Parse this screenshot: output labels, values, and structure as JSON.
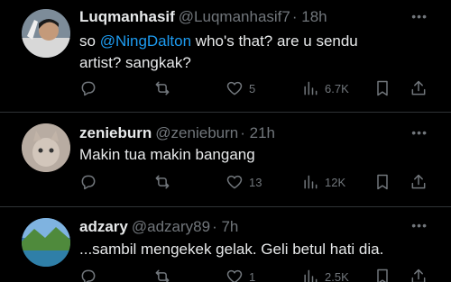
{
  "tweets": [
    {
      "name": "Luqmanhasif",
      "handle": "@Luqmanhasif7",
      "time": "· 18h",
      "text_prefix": "so ",
      "mention": "@NingDalton",
      "text_rest": " who's that?  are u sendu",
      "text_line2": "artist? sangkak?",
      "likes": "5",
      "views": "6.7K",
      "avatar_colors": [
        "#6b7a8a",
        "#e8e8e8"
      ]
    },
    {
      "name": "zenieburn",
      "handle": "@zenieburn",
      "time": "· 21h",
      "text": "Makin tua makin bangang",
      "likes": "13",
      "views": "12K",
      "avatar_colors": [
        "#9a8b80",
        "#c9bcb0"
      ]
    },
    {
      "name": "adzary",
      "handle": "@adzary89",
      "time": "· 7h",
      "text": "...sambil mengekek gelak. Geli betul hati dia.",
      "likes": "1",
      "views": "2.5K",
      "avatar_colors": [
        "#3a7bb8",
        "#4f8a3c"
      ]
    }
  ],
  "icons": {
    "reply": "reply-icon",
    "retweet": "retweet-icon",
    "like": "heart-icon",
    "views": "views-icon",
    "bookmark": "bookmark-icon",
    "share": "share-icon",
    "more": "more-icon"
  },
  "more_glyph": "•••"
}
